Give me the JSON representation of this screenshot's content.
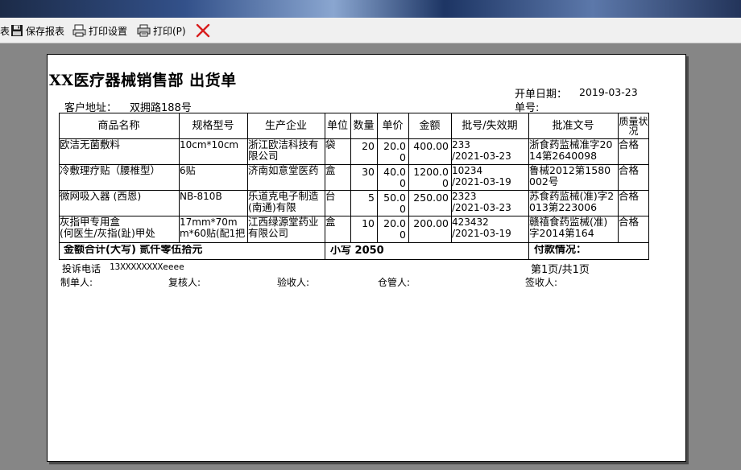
{
  "toolbar": {
    "save_label": "保存报表",
    "print_setup_label": "打印设置",
    "print_label": "打印(P)",
    "partial_label": "表"
  },
  "doc": {
    "title": "XX医疗器械销售部  出货单",
    "date_label": "开单日期：",
    "date_value": "2019-03-23",
    "address_label": "客户地址：",
    "address_value": "双拥路188号",
    "order_no_label": "单号:",
    "order_no_value": ""
  },
  "table": {
    "headers": [
      "商品名称",
      "规格型号",
      "生产企业",
      "单位",
      "数量",
      "单价",
      "金额",
      "批号/失效期",
      "批准文号",
      "质量状况"
    ],
    "rows": [
      [
        "欧洁无菌敷料",
        "10cm*10cm",
        "浙江欧洁科技有限公司",
        "袋",
        "20",
        "20.00",
        "400.00",
        "233\n/2021-03-23",
        "浙食药监械准字2014第2640098",
        "合格"
      ],
      [
        "冷敷理疗贴（腰椎型）",
        "6贴",
        "济南如意堂医药",
        "盒",
        "30",
        "40.00",
        "1200.00",
        "10234\n/2021-03-19",
        "鲁械2012第1580002号",
        "合格"
      ],
      [
        "微网吸入器 (西恩)",
        "NB-810B",
        "乐道克电子制造(南通)有限",
        "台",
        "5",
        "50.00",
        "250.00",
        "2323\n/2021-03-23",
        "苏食药监械(准)字2013第223006",
        "合格"
      ],
      [
        "灰指甲专用盒\n(何医生/灰指(趾)甲处",
        "17mm*70mm*60贴(配1把",
        "江西绿源堂药业有限公司",
        "盒",
        "10",
        "20.00",
        "200.00",
        "423432\n/2021-03-19",
        "赣禧食药监械(准)字2014第164",
        "合格"
      ]
    ],
    "total_caps_label": "金额合计(大写) 贰仟零伍拾元",
    "total_small_label": "小写  2050",
    "payment_label": "付款情况："
  },
  "footer": {
    "phone_label": "投诉电话",
    "phone_value": "13XXXXXXXXeeee",
    "page_info": "第1页/共1页",
    "maker": "制单人:",
    "reviewer": "复核人:",
    "receiver": "验收人:",
    "warehouse": "仓管人:",
    "signer": "签收人:"
  },
  "colors": {
    "background": "#868686",
    "paper": "#ffffff",
    "toolbar": "#f0f0f0",
    "close_icon": "#d81e1e"
  }
}
